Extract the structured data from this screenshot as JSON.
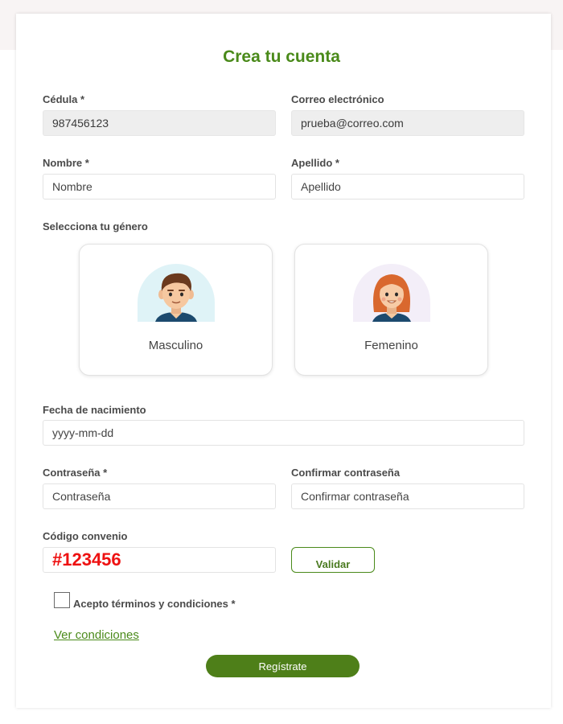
{
  "form": {
    "title": "Crea tu cuenta",
    "cedula": {
      "label": "Cédula *",
      "value": "987456123"
    },
    "email": {
      "label": "Correo electrónico",
      "value": "prueba@correo.com"
    },
    "first_name": {
      "label": "Nombre *",
      "placeholder": "Nombre"
    },
    "last_name": {
      "label": "Apellido *",
      "placeholder": "Apellido"
    },
    "gender": {
      "label": "Selecciona tu género",
      "options": [
        {
          "label": "Masculino",
          "icon": "male-avatar-icon"
        },
        {
          "label": "Femenino",
          "icon": "female-avatar-icon"
        }
      ]
    },
    "birthdate": {
      "label": "Fecha de nacimiento",
      "placeholder": "yyyy-mm-dd"
    },
    "password": {
      "label": "Contraseña *",
      "placeholder": "Contraseña"
    },
    "confirm_password": {
      "label": "Confirmar contraseña",
      "placeholder": "Confirmar contraseña"
    },
    "agreement_code": {
      "label": "Código convenio",
      "value": "#123456"
    },
    "validate_label": "Validar",
    "terms": {
      "label": "Acepto términos y condiciones *",
      "checked": false
    },
    "view_conditions": "Ver condiciones",
    "submit_label": "Regístrate"
  },
  "colors": {
    "brand_green": "#4a8a1a",
    "button_green": "#4e7f19",
    "code_red": "#ee1111",
    "filled_field_bg": "#eeeeee"
  }
}
